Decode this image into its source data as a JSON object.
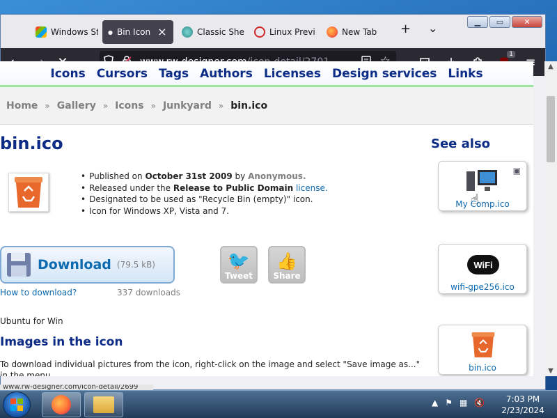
{
  "browser": {
    "tabs": [
      {
        "label": "Windows St",
        "icon": "windows-tab-icon",
        "active": false
      },
      {
        "label": "Bin Icon",
        "icon": "loading-dot-icon",
        "active": true
      },
      {
        "label": "Classic Shel",
        "icon": "classic-shell-tab-icon",
        "active": false
      },
      {
        "label": "Linux Previ",
        "icon": "power-tab-icon",
        "active": false
      },
      {
        "label": "New Tab",
        "icon": "firefox-tab-icon",
        "active": false
      }
    ],
    "new_tab_symbol": "+",
    "tab_list_symbol": "⌄",
    "url_host": "www.rw-designer.com",
    "url_path": "/icon-detail/2701",
    "extension_badge": "1"
  },
  "site_nav": {
    "items": [
      "Icons",
      "Cursors",
      "Tags",
      "Authors",
      "Licenses",
      "Design services",
      "Links"
    ]
  },
  "breadcrumb": {
    "items": [
      "Home",
      "Gallery",
      "Icons",
      "Junkyard",
      "bin.ico"
    ],
    "separator": "»"
  },
  "page": {
    "title": "bin.ico",
    "see_also_heading": "See also",
    "facts": {
      "published_prefix": "Published on ",
      "published_date": "October 31st 2009",
      "published_by": " by ",
      "author": "Anonymous.",
      "released_prefix": "Released under the ",
      "license_name": "Release to Public Domain",
      "license_link": "license.",
      "designated": "Designated to be used as \"Recycle Bin (empty)\" icon.",
      "platforms": "Icon for Windows XP, Vista and 7."
    },
    "download": {
      "label": "Download",
      "size": "(79.5 kB)",
      "how_to": "How to download?",
      "count": "337 downloads"
    },
    "social": {
      "tweet": "Tweet",
      "share": "Share"
    },
    "ubuntu_text": "Ubuntu for Win",
    "images_heading": "Images in the icon",
    "images_text": "To download individual pictures from the icon, right-click on the image and select \"Save image as...\" in the menu."
  },
  "see_also": [
    {
      "caption": "My Comp.ico",
      "icon": "computer-icon"
    },
    {
      "caption": "wifi-gpe256.ico",
      "icon": "wifi-icon"
    },
    {
      "caption": "bin.ico",
      "icon": "recycle-bin-icon"
    }
  ],
  "status_url": "www.rw-designer.com/icon-detail/2699",
  "taskbar": {
    "time": "7:03 PM",
    "date": "2/23/2024"
  },
  "colors": {
    "link": "#0c6ab0",
    "heading": "#0c2c86",
    "bin_orange": "#e8672a"
  }
}
